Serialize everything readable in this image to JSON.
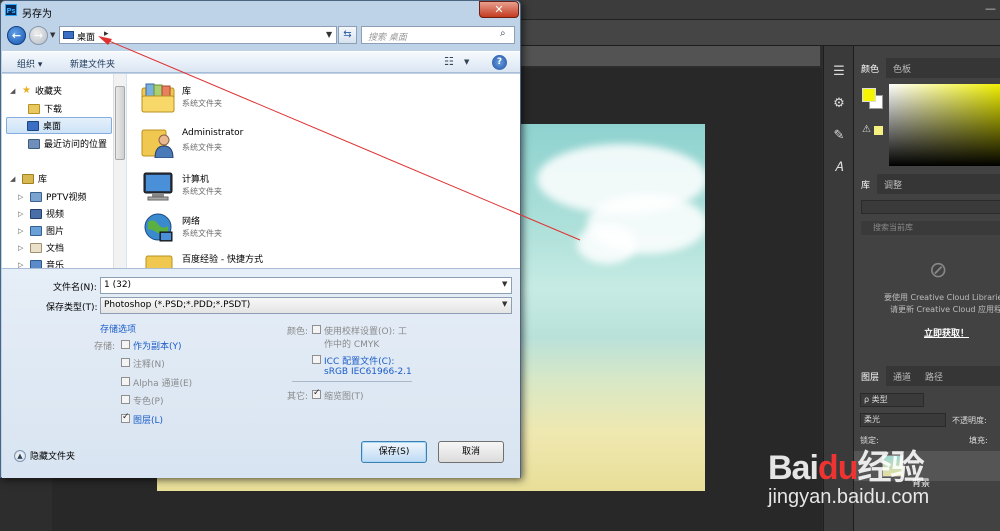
{
  "photoshop": {
    "panels": {
      "color_tab": "颜色",
      "swatches_tab": "色板",
      "library_tab": "库",
      "adjust_tab": "调整",
      "library_search_placeholder": "搜索当前库",
      "cc_message_1": "要使用 Creative Cloud Libraries",
      "cc_message_2": "请更新 Creative Cloud 应用程序",
      "cc_link": "立即获取！",
      "layers_tab": "图层",
      "channels_tab": "通道",
      "paths_tab": "路径",
      "layer_kind": "ρ 类型",
      "blend_mode": "柔光",
      "opacity_label": "不透明度:",
      "lock_label": "锁定:",
      "fill_label": "填充:",
      "layer_name": "背景"
    },
    "colors": {
      "foreground": "#f5f500",
      "background": "#ffffff"
    }
  },
  "watermark": {
    "logo": "Bai",
    "logo_paw": "du",
    "logo_tail": "经验",
    "url": "jingyan.baidu.com"
  },
  "dialog": {
    "title": "另存为",
    "close_label": "✕",
    "address": {
      "current": "桌面",
      "separator": "▸",
      "search_placeholder": "搜索 桌面"
    },
    "toolbar": {
      "organize": "组织 ▾",
      "new_folder": "新建文件夹",
      "help": "?"
    },
    "nav": {
      "favorites": "收藏夹",
      "downloads": "下载",
      "desktop": "桌面",
      "recent": "最近访问的位置",
      "libraries": "库",
      "pptv": "PPTV视频",
      "videos": "视频",
      "pictures": "图片",
      "documents": "文档",
      "music": "音乐"
    },
    "files": [
      {
        "name": "库",
        "sub": "系统文件夹"
      },
      {
        "name": "Administrator",
        "sub": "系统文件夹"
      },
      {
        "name": "计算机",
        "sub": "系统文件夹"
      },
      {
        "name": "网络",
        "sub": "系统文件夹"
      },
      {
        "name": "百度经验 - 快捷方式",
        "sub": ""
      }
    ],
    "filename_label": "文件名(N):",
    "filename_value": "1 (32)",
    "format_label": "保存类型(T):",
    "format_value": "Photoshop (*.PSD;*.PDD;*.PSDT)",
    "save_options_title": "存储选项",
    "storage_label": "存储:",
    "opt_as_copy": "作为副本(Y)",
    "opt_notes": "注释(N)",
    "opt_alpha": "Alpha 通道(E)",
    "opt_spot": "专色(P)",
    "opt_layers": "图层(L)",
    "color_label": "颜色:",
    "opt_proof_1": "使用校样设置(O): 工",
    "opt_proof_2": "作中的 CMYK",
    "opt_icc_1": "ICC 配置文件(C):",
    "opt_icc_2": "sRGB IEC61966-2.1",
    "other_label": "其它:",
    "opt_thumbnail": "缩览图(T)",
    "hide_folders": "隐藏文件夹",
    "save_button": "保存(S)",
    "cancel_button": "取消"
  }
}
